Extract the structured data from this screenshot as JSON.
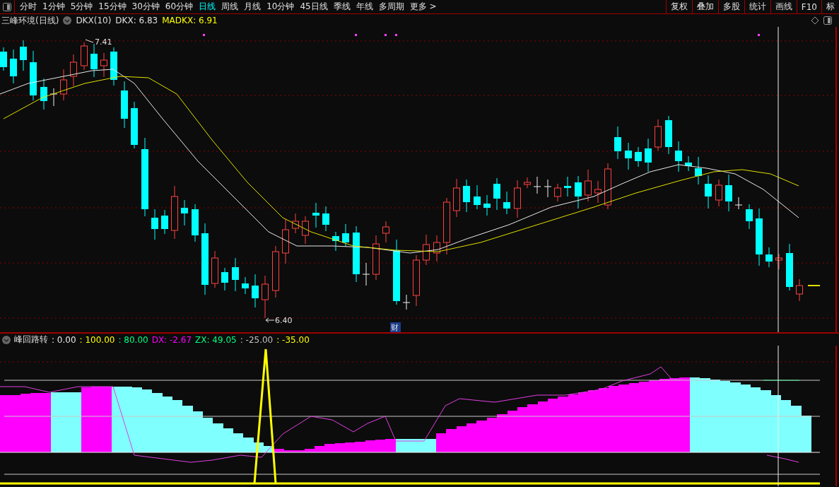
{
  "toolbar": {
    "tabs": [
      {
        "label": "分时",
        "selected": false
      },
      {
        "label": "1分钟",
        "selected": false
      },
      {
        "label": "5分钟",
        "selected": false
      },
      {
        "label": "15分钟",
        "selected": false
      },
      {
        "label": "30分钟",
        "selected": false
      },
      {
        "label": "60分钟",
        "selected": false
      },
      {
        "label": "日线",
        "selected": true
      },
      {
        "label": "周线",
        "selected": false
      },
      {
        "label": "月线",
        "selected": false
      },
      {
        "label": "10分钟",
        "selected": false
      },
      {
        "label": "45日线",
        "selected": false
      },
      {
        "label": "季线",
        "selected": false
      },
      {
        "label": "年线",
        "selected": false
      },
      {
        "label": "多周期",
        "selected": false
      },
      {
        "label": "更多 >",
        "selected": false
      }
    ],
    "buttons": [
      "复权",
      "叠加",
      "多股",
      "统计",
      "画线",
      "F10",
      "标"
    ]
  },
  "main_chart": {
    "title": "三峰环境(日线)",
    "indicator": "DKX(10)",
    "values": [
      {
        "text": "DKX: 6.83",
        "color": "#e0e0e0"
      },
      {
        "text": "MADKX: 6.91",
        "color": "#ffff00"
      }
    ],
    "high_label": "7.41",
    "low_label": "6.40",
    "badge": "财"
  },
  "sub_chart": {
    "title": "峰回路转",
    "values": [
      {
        "text": ": 0.00",
        "color": "#e8e8e8"
      },
      {
        "text": ": 100.00",
        "color": "#ffff00"
      },
      {
        "text": ": 80.00",
        "color": "#00ff80"
      },
      {
        "text": "DX: -2.67",
        "color": "#ff00ff"
      },
      {
        "text": "ZX: 49.05",
        "color": "#00ff80"
      },
      {
        "text": ": -25.00",
        "color": "#c0c0c0"
      },
      {
        "text": ": -35.00",
        "color": "#ffff00"
      }
    ]
  }
}
